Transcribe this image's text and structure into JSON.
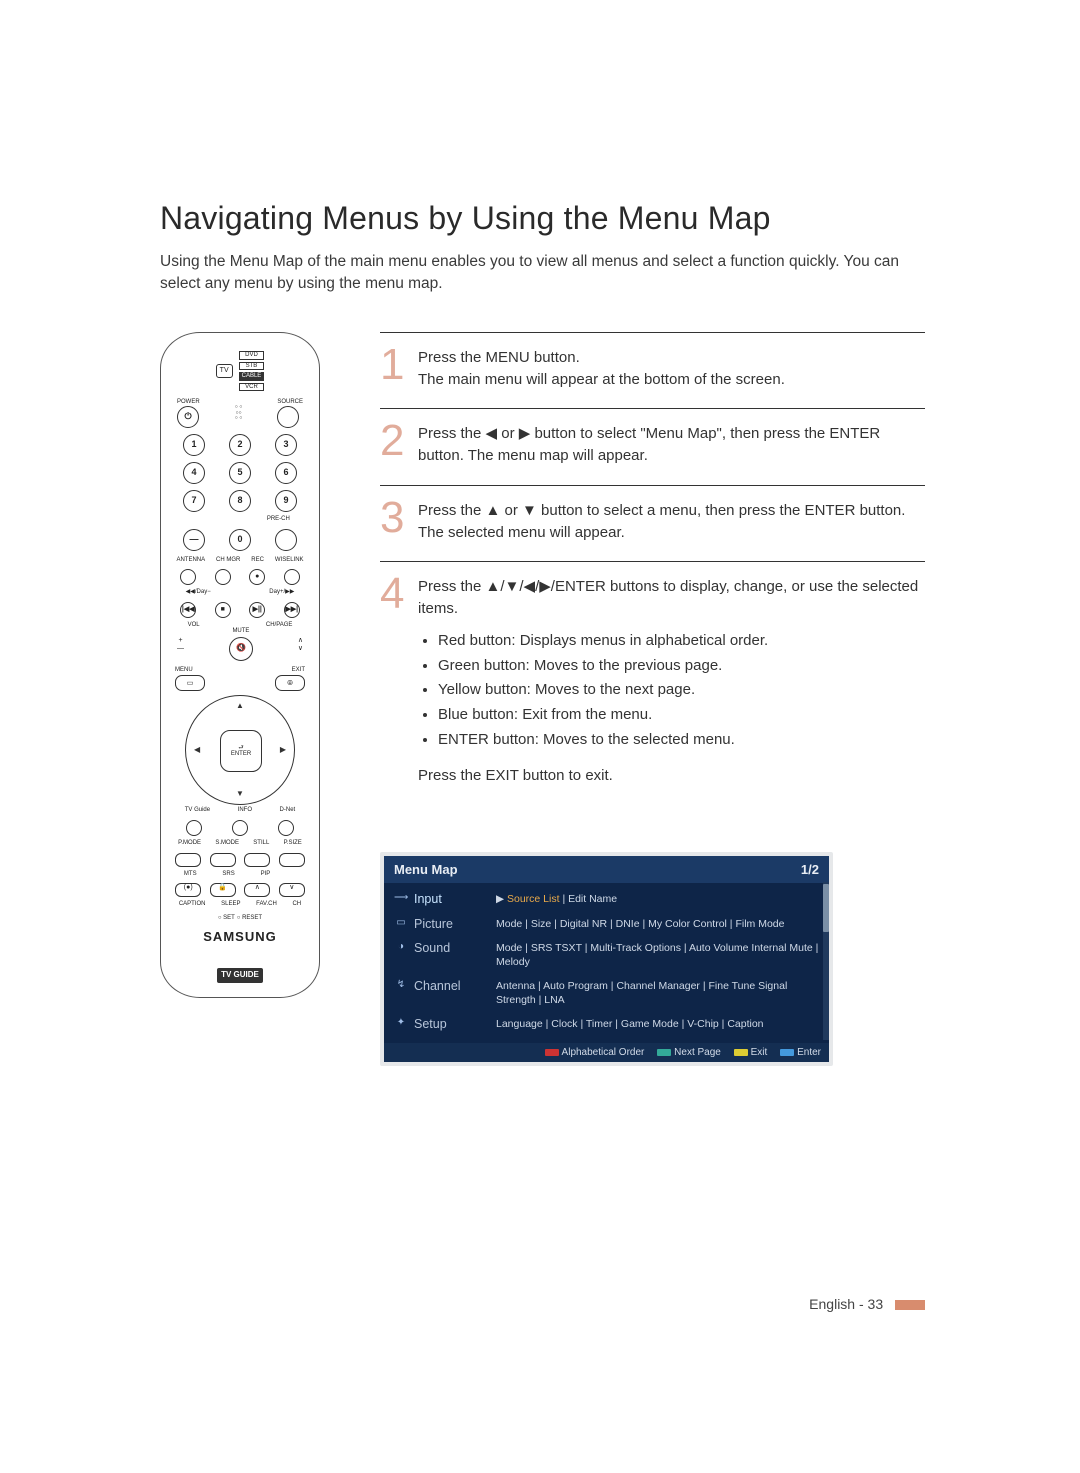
{
  "title": "Navigating Menus by Using the Menu Map",
  "intro": "Using the Menu Map of the main menu enables you to view all menus and select a function quickly. You can select any menu by using the menu map.",
  "steps": [
    {
      "num": "1",
      "text_a": "Press the MENU button.",
      "text_b": "The main menu will appear at the bottom of the screen."
    },
    {
      "num": "2",
      "text_a": "Press the ◀ or ▶ button to select \"Menu Map\", then press the ENTER button. The menu map will appear."
    },
    {
      "num": "3",
      "text_a": "Press the ▲ or ▼ button to select a menu, then press the ENTER button. The selected menu will appear."
    },
    {
      "num": "4",
      "text_a": "Press the ▲/▼/◀/▶/ENTER buttons to display, change, or use the selected items.",
      "bullets": [
        "Red button: Displays menus in alphabetical order.",
        "Green button: Moves to the previous page.",
        "Yellow button: Moves to the next page.",
        "Blue button: Exit from the menu.",
        "ENTER button: Moves to the selected menu."
      ],
      "after": "Press the EXIT button to exit."
    }
  ],
  "remote": {
    "brand": "SAMSUNG",
    "tvguide": "TV GUIDE",
    "top_sources": {
      "tv": "TV",
      "dvd": "DVD",
      "stb": "STB",
      "cable": "CABLE",
      "vcr": "VCR"
    },
    "labels": {
      "power": "POWER",
      "source": "SOURCE",
      "prech": "PRE-CH",
      "antenna": "ANTENNA",
      "chmgr": "CH MGR",
      "rec": "REC",
      "wiselink": "WISELINK",
      "day_minus": "◀◀/Day−",
      "day_plus": "Day+/▶▶",
      "vol": "VOL",
      "chpage": "CH/PAGE",
      "mute": "MUTE",
      "menu": "MENU",
      "exit": "EXIT",
      "enter": "ENTER",
      "tvguide_l": "TV Guide",
      "info": "INFO",
      "dnet": "D-Net",
      "pmode": "P.MODE",
      "smode": "S.MODE",
      "still": "STILL",
      "psize": "P.SIZE",
      "mts": "MTS",
      "srs": "SRS",
      "pip": "PIP",
      "caption": "CAPTION",
      "sleep": "SLEEP",
      "favch": "FAV.CH",
      "ch": "CH",
      "set": "SET",
      "reset": "RESET"
    }
  },
  "menu_map": {
    "title": "Menu Map",
    "page": "1/2",
    "rows": [
      {
        "label": "Input",
        "sub_highlight": "Source List",
        "sub_rest": " | Edit Name"
      },
      {
        "label": "Picture",
        "sub": "Mode | Size | Digital NR | DNIe | My Color Control | Film Mode"
      },
      {
        "label": "Sound",
        "sub": "Mode | SRS TSXT | Multi-Track Options | Auto Volume Internal Mute | Melody"
      },
      {
        "label": "Channel",
        "sub": "Antenna | Auto Program | Channel Manager | Fine Tune Signal Strength | LNA"
      },
      {
        "label": "Setup",
        "sub": "Language | Clock | Timer | Game Mode | V-Chip | Caption"
      }
    ],
    "footer": {
      "alpha": "Alphabetical Order",
      "next": "Next Page",
      "exit": "Exit",
      "enter": "Enter"
    }
  },
  "page_footer": "English - 33"
}
